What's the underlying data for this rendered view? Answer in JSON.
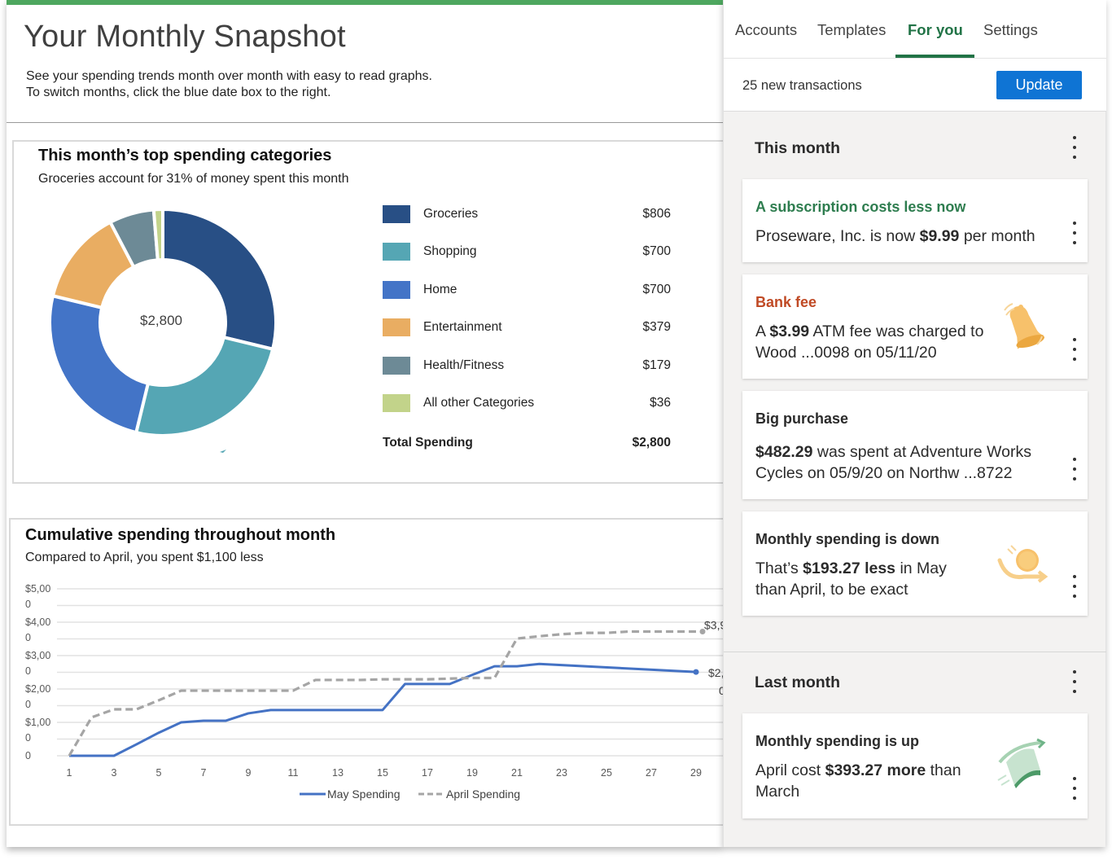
{
  "page": {
    "title": "Your Monthly Snapshot",
    "description_line1": "See your spending trends month over month with easy to read graphs.",
    "description_line2": "To switch months, click the blue date box to the right.",
    "accent_color": "#4ea75f"
  },
  "categories_card": {
    "title": "This month’s top spending categories",
    "subtitle": "Groceries account for 31% of money spent this month",
    "center_label": "$2,800",
    "items": [
      {
        "name": "Groceries",
        "value_label": "$806",
        "color": "#284f85"
      },
      {
        "name": "Shopping",
        "value_label": "$700",
        "color": "#55a6b4"
      },
      {
        "name": "Home",
        "value_label": "$700",
        "color": "#4374c7"
      },
      {
        "name": "Entertainment",
        "value_label": "$379",
        "color": "#e9ad62"
      },
      {
        "name": "Health/Fitness",
        "value_label": "$179",
        "color": "#6d8a96"
      },
      {
        "name": "All other Categories",
        "value_label": "$36",
        "color": "#c2d38a"
      }
    ],
    "total_label": "Total Spending",
    "total_value": "$2,800"
  },
  "cumulative_card": {
    "title": "Cumulative spending throughout month",
    "subtitle": "Compared to April, you spent $1,100 less"
  },
  "chart_data": [
    {
      "type": "pie",
      "title": "This month’s top spending categories",
      "categories": [
        "Groceries",
        "Shopping",
        "Home",
        "Entertainment",
        "Health/Fitness",
        "All other Categories"
      ],
      "values": [
        806,
        700,
        700,
        379,
        179,
        36
      ],
      "center_text": "$2,800",
      "legend": "right"
    },
    {
      "type": "line",
      "title": "Cumulative spending throughout month",
      "xlabel": "",
      "ylabel": "",
      "x_ticks": [
        1,
        3,
        5,
        7,
        9,
        11,
        13,
        15,
        17,
        19,
        21,
        23,
        25,
        27,
        29
      ],
      "y_ticks": [
        {
          "value": 0,
          "line1": "$0",
          "line2": ""
        },
        {
          "value": 1000,
          "line1": "$1,00",
          "line2": "0"
        },
        {
          "value": 2000,
          "line1": "$2,00",
          "line2": "0"
        },
        {
          "value": 3000,
          "line1": "$3,00",
          "line2": "0"
        },
        {
          "value": 4000,
          "line1": "$4,00",
          "line2": "0"
        },
        {
          "value": 5000,
          "line1": "$5,00",
          "line2": "0"
        }
      ],
      "ylim": [
        0,
        5000
      ],
      "xlim": [
        1,
        29
      ],
      "grid_step": 500,
      "grid": true,
      "legend": "bottom",
      "series": [
        {
          "name": "May Spending",
          "color": "#4472c4",
          "style": "solid",
          "x": [
            1,
            2,
            3,
            4,
            5,
            6,
            7,
            8,
            9,
            10,
            11,
            12,
            13,
            14,
            15,
            16,
            17,
            18,
            19,
            20,
            21,
            22,
            29
          ],
          "values": [
            0,
            0,
            0,
            340,
            690,
            1000,
            1050,
            1050,
            1270,
            1370,
            1370,
            1370,
            1370,
            1370,
            1370,
            2150,
            2150,
            2150,
            2420,
            2680,
            2680,
            2750,
            2510
          ],
          "end_label": "$2,",
          "end_label_line2": "0"
        },
        {
          "name": "April Spending",
          "color": "#a5a5a5",
          "style": "dashed",
          "x": [
            1,
            2,
            3,
            4,
            5,
            6,
            7,
            8,
            9,
            10,
            11,
            12,
            13,
            14,
            15,
            16,
            17,
            18,
            19,
            20,
            21,
            22,
            23,
            24,
            25,
            26,
            27,
            28,
            29
          ],
          "values": [
            0,
            1150,
            1390,
            1390,
            1660,
            1950,
            1950,
            1950,
            1950,
            1950,
            1950,
            2270,
            2270,
            2270,
            2290,
            2290,
            2290,
            2310,
            2330,
            2330,
            3510,
            3580,
            3640,
            3680,
            3680,
            3720,
            3720,
            3720,
            3720
          ],
          "end_label": "$3,9"
        }
      ]
    }
  ],
  "pane": {
    "tabs": [
      {
        "label": "Accounts",
        "active": false
      },
      {
        "label": "Templates",
        "active": false
      },
      {
        "label": "For you",
        "active": true
      },
      {
        "label": "Settings",
        "active": false
      }
    ],
    "new_transactions": "25 new transactions",
    "update_button": "Update",
    "update_color": "#0f74d4",
    "tab_active_color": "#217346",
    "this_month": {
      "title": "This month",
      "cards": [
        {
          "title": "A subscription costs less now",
          "body_pre": "Proseware, Inc. is now ",
          "body_bold": "$9.99",
          "body_post": " per month",
          "icon": "none"
        },
        {
          "title": "Bank fee",
          "body_pre": "A ",
          "body_bold": "$3.99",
          "body_post": " ATM fee was charged to Wood ...0098 on 05/11/20",
          "icon": "bell-icon"
        },
        {
          "title": "Big purchase",
          "body_pre": "",
          "body_bold": "$482.29",
          "body_post": " was spent at Adventure Works Cycles on 05/9/20 on Northw ...8722",
          "icon": "none"
        },
        {
          "title": "Monthly spending is down",
          "body_pre": "That’s ",
          "body_bold": "$193.27 less",
          "body_post": " in May than April, to be exact",
          "icon": "coin-down-icon"
        }
      ]
    },
    "last_month": {
      "title": "Last month",
      "cards": [
        {
          "title": "Monthly spending is up",
          "body_pre": "April cost ",
          "body_bold": "$393.27 more",
          "body_post": " than March",
          "icon": "money-up-icon"
        }
      ]
    }
  }
}
